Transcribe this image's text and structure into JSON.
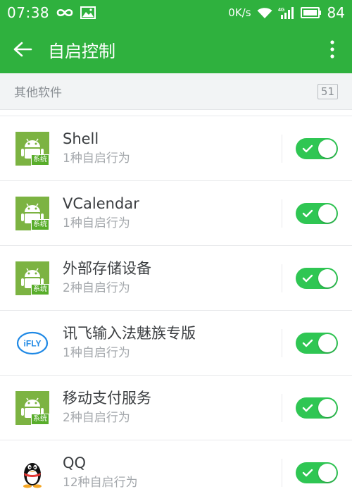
{
  "status_bar": {
    "time": "07:38",
    "network_speed": "0K/s",
    "battery_level": "84",
    "icons": [
      "infinity-icon",
      "image-icon",
      "wifi-icon",
      "4g-signal-icon",
      "battery-icon"
    ]
  },
  "app_bar": {
    "title": "自启控制",
    "icons": [
      "back-arrow-icon",
      "more-vertical-icon"
    ]
  },
  "section": {
    "title": "其他软件",
    "count": "51"
  },
  "apps": [
    {
      "name": "Shell",
      "subtitle": "1种自启行为",
      "icon": "android-icon",
      "tag": "系统",
      "enabled": true
    },
    {
      "name": "VCalendar",
      "subtitle": "1种自启行为",
      "icon": "android-icon",
      "tag": "系统",
      "enabled": true
    },
    {
      "name": "外部存储设备",
      "subtitle": "2种自启行为",
      "icon": "android-icon",
      "tag": "系统",
      "enabled": true
    },
    {
      "name": "讯飞输入法魅族专版",
      "subtitle": "1种自启行为",
      "icon": "ifly-icon",
      "logo_text": "iFLY",
      "enabled": true
    },
    {
      "name": "移动支付服务",
      "subtitle": "2种自启行为",
      "icon": "android-icon",
      "tag": "系统",
      "enabled": true
    },
    {
      "name": "QQ",
      "subtitle": "12种自启行为",
      "icon": "qq-penguin-icon",
      "enabled": true
    }
  ],
  "colors": {
    "primary": "#2fb13e",
    "toggle_on": "#2fc653",
    "android_green": "#7cb342",
    "tag_green": "#58ad2a"
  }
}
